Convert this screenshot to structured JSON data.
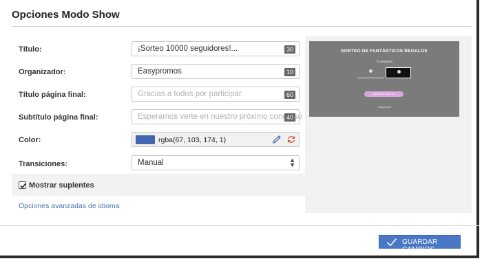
{
  "page_title": "Opciones Modo Show",
  "form": {
    "titulo": {
      "label": "Título:",
      "value": "¡Sorteo 10000 seguidores!...",
      "counter": "30"
    },
    "organizador": {
      "label": "Organizador:",
      "value": "Easypromos",
      "counter": "10"
    },
    "titulo_final": {
      "label": "Título página final:",
      "placeholder": "Gracias a todos por participar",
      "counter": "60"
    },
    "subtitulo_final": {
      "label": "Subtítulo página final:",
      "placeholder": "Esperamos verte en nuestro próximo concurso",
      "counter": "40"
    },
    "color": {
      "label": "Color:",
      "value": "rgba(67, 103, 174, 1)",
      "swatch": "#4367ae",
      "icons": [
        "pencil-icon",
        "reset-icon"
      ]
    },
    "transiciones": {
      "label": "Transiciones:",
      "selected": "Manual"
    }
  },
  "mostrar_suplentes": {
    "label": "Mostrar suplentes",
    "checked": true
  },
  "advanced_link": "Opciones avanzadas de idioma",
  "preview": {
    "title": "SORTEO DE FANTÁSTICOS REGALOS",
    "subtitle": "Tu empresa",
    "button": "EMPEZAR SORTEO",
    "logo": "easypromos",
    "background": "#7b7b7b",
    "button_color": "#d9a6de"
  },
  "footer": {
    "save_label": "GUARDAR CAMBIOS",
    "save_color": "#4a78c4"
  }
}
